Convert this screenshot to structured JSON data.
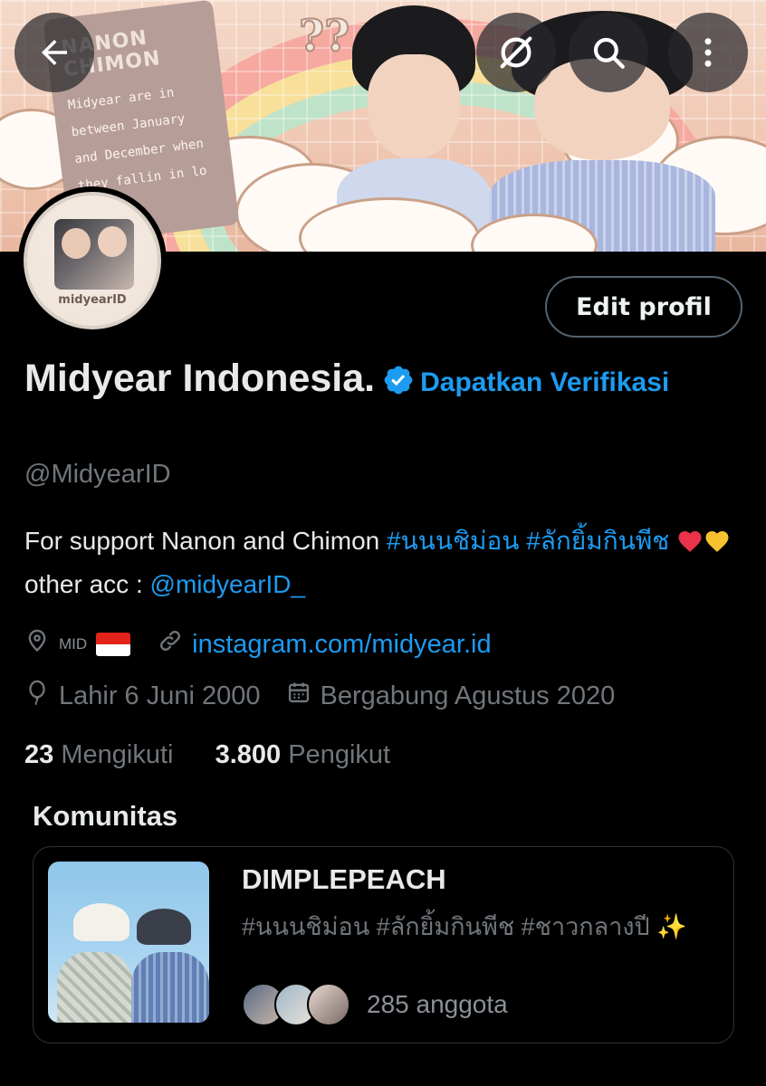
{
  "banner": {
    "note_title": "NANON\nCHIMON",
    "note_body": "Midyear are in between January and December when they fallin in lo"
  },
  "header": {
    "back_icon": "arrow-left-icon",
    "grok_icon": "grok-icon",
    "search_icon": "search-icon",
    "more_icon": "more-vertical-icon"
  },
  "avatar": {
    "label": "midyearID"
  },
  "profile": {
    "edit_button": "Edit profil",
    "name": "Midyear Indonesia.",
    "get_verified": "Dapatkan Verifikasi",
    "handle": "@MidyearID",
    "bio_text": "For support Nanon and Chimon ",
    "bio_tag1": "#นนนชิม่อน",
    "bio_tag2": "#ลักยิ้มกินพีช",
    "bio_middle": " other acc : ",
    "bio_mention": "@midyearID_",
    "location": "MID",
    "website": "instagram.com/midyear.id",
    "birthday": "Lahir 6 Juni 2000",
    "joined": "Bergabung Agustus 2020",
    "following_count": "23",
    "following_label": "Mengikuti",
    "followers_count": "3.800",
    "followers_label": "Pengikut"
  },
  "communities": {
    "heading": "Komunitas",
    "items": [
      {
        "name": "DIMPLEPEACH",
        "description": "#นนนชิม่อน #ลักยิ้มกินพีช #ชาวกลางปี ✨",
        "members": "285 anggota"
      }
    ]
  },
  "colors": {
    "accent": "#1d9bf0",
    "text_primary": "#e7e9ea",
    "text_secondary": "#71767b",
    "border": "#2f3336"
  }
}
